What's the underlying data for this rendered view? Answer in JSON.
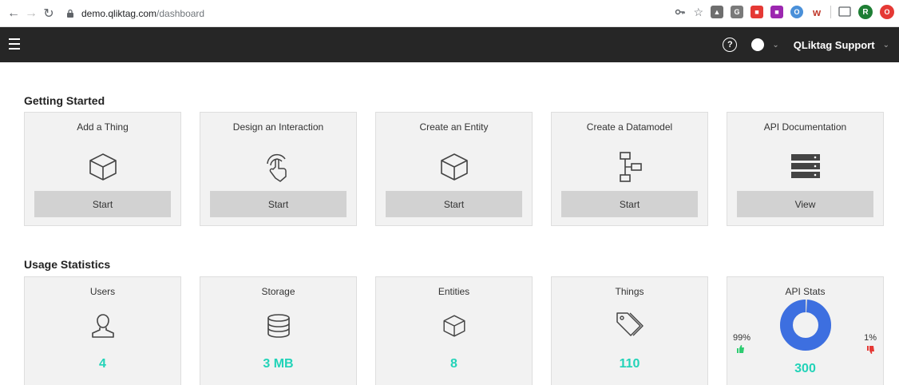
{
  "browser": {
    "url_host": "demo.qliktag.com",
    "url_path": "/dashboard",
    "profile_initial": "R"
  },
  "header": {
    "help_glyph": "?",
    "user_label": "QLiktag Support"
  },
  "getting_started": {
    "title": "Getting Started",
    "cards": [
      {
        "title": "Add a Thing",
        "button": "Start",
        "icon": "cube-icon"
      },
      {
        "title": "Design an Interaction",
        "button": "Start",
        "icon": "tap-hand-icon"
      },
      {
        "title": "Create an Entity",
        "button": "Start",
        "icon": "cube-icon"
      },
      {
        "title": "Create a Datamodel",
        "button": "Start",
        "icon": "datamodel-icon"
      },
      {
        "title": "API Documentation",
        "button": "View",
        "icon": "server-icon"
      }
    ]
  },
  "usage": {
    "title": "Usage Statistics",
    "cards": [
      {
        "title": "Users",
        "value": "4",
        "icon": "user-icon"
      },
      {
        "title": "Storage",
        "value": "3 MB",
        "icon": "database-icon"
      },
      {
        "title": "Entities",
        "value": "8",
        "icon": "cube-icon"
      },
      {
        "title": "Things",
        "value": "110",
        "icon": "tags-icon"
      }
    ],
    "api": {
      "title": "API Stats",
      "success_pct": "99%",
      "fail_pct": "1%",
      "total": "300",
      "success_fraction": 0.99,
      "colors": {
        "success": "#3d6fe0",
        "fail": "#d9d9d9"
      }
    }
  },
  "colors": {
    "accent": "#22d3b8",
    "header_bg": "#262626",
    "card_bg": "#f2f2f2",
    "button_bg": "#d2d2d2"
  }
}
